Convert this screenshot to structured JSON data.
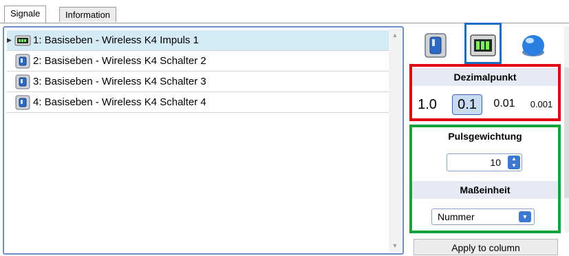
{
  "tabs": [
    {
      "label": "Signale"
    },
    {
      "label": "Information"
    }
  ],
  "signals": [
    {
      "label": "1: Basiseben - Wireless K4 Impuls 1",
      "icon": "counter-display-icon"
    },
    {
      "label": "2: Basiseben - Wireless K4 Schalter 2",
      "icon": "switch-icon"
    },
    {
      "label": "3: Basiseben - Wireless K4 Schalter 3",
      "icon": "switch-icon"
    },
    {
      "label": "4: Basiseben - Wireless K4 Schalter 4",
      "icon": "switch-icon"
    }
  ],
  "right": {
    "decimal": {
      "title": "Dezimalpunkt",
      "options": [
        "1.0",
        "0.1",
        "0.01",
        "0.001"
      ],
      "selected": "0.1"
    },
    "pulse": {
      "title": "Pulsgewichtung",
      "value": "10"
    },
    "unit": {
      "title": "Maßeinheit",
      "value": "Nummer"
    },
    "apply_label": "Apply to column"
  },
  "colors": {
    "accent_blue": "#1c6fbf",
    "highlight_red": "#e00010",
    "highlight_green": "#15a33b",
    "selection": "#d4eaf4"
  }
}
